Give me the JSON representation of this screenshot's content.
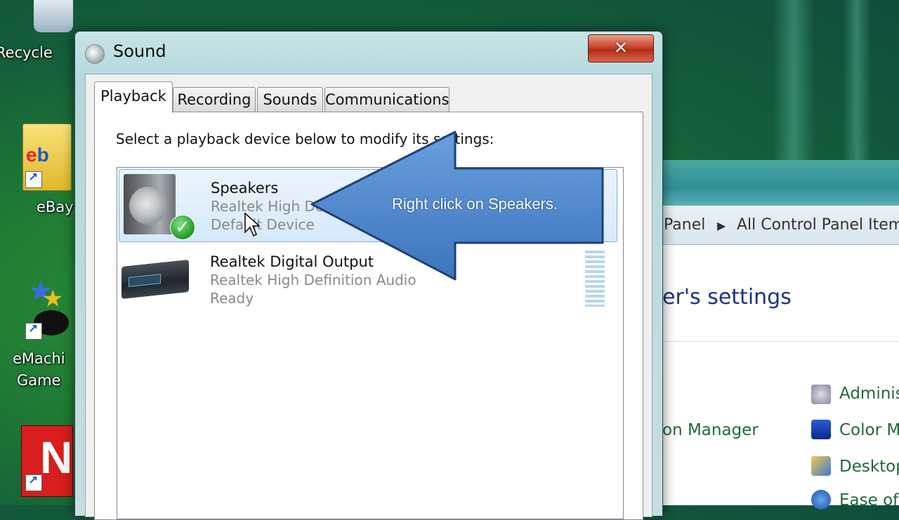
{
  "desktop": {
    "icons": [
      {
        "label": "Recycle",
        "icon": "recycle-bin-icon"
      },
      {
        "label": "eBay",
        "icon": "ebay-icon"
      },
      {
        "label": "eMachi\nGame",
        "icon": "emachines-games-icon"
      },
      {
        "label": "",
        "icon": "netflix-icon"
      }
    ]
  },
  "control_panel": {
    "breadcrumb": [
      "Panel",
      "All Control Panel Item"
    ],
    "heading": "er's settings",
    "links": [
      "Adminis",
      "on Manager",
      "Color M",
      "Desktop",
      "Ease of"
    ]
  },
  "dialog": {
    "title": "Sound",
    "close_label": "✕",
    "tabs": [
      "Playback",
      "Recording",
      "Sounds",
      "Communications"
    ],
    "active_tab": "Playback",
    "instruction": "Select a playback device below to modify its settings:",
    "devices": [
      {
        "name": "Speakers",
        "driver": "Realtek High Definition Audio",
        "status": "Default Device",
        "icon": "speaker-icon",
        "selected": true
      },
      {
        "name": "Realtek Digital Output",
        "driver": "Realtek High Definition Audio",
        "status": "Ready",
        "icon": "digital-output-icon",
        "selected": false
      }
    ]
  },
  "callout": {
    "text": "Right click on Speakers.",
    "color": "#4a86c8"
  },
  "colors": {
    "accent": "#4a86c8",
    "close": "#c8452c",
    "default_check": "#1f9a2a"
  }
}
